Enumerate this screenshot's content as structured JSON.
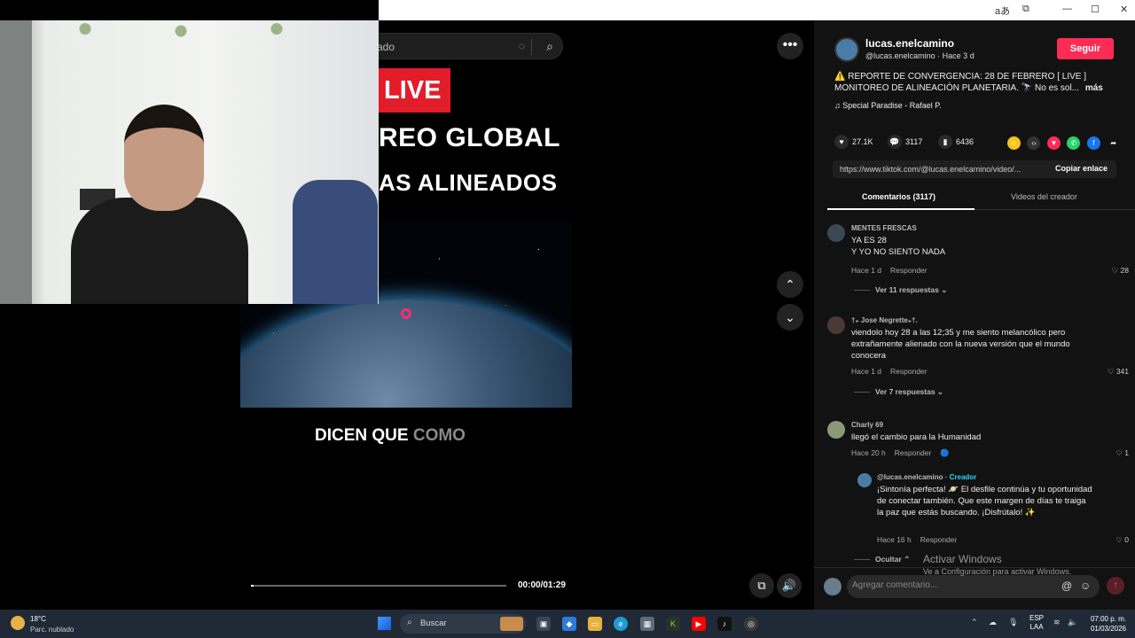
{
  "titlebar": {
    "controls": [
      "aあ",
      "⧉",
      "—",
      "☐",
      "✕"
    ]
  },
  "video": {
    "search_text": "ado",
    "live_badge": "LIVE",
    "headline_1": "REO GLOBAL",
    "headline_2": "AS ALINEADOS",
    "subtitle_bright": "DICEN QUE",
    "subtitle_dim": "COMO",
    "time": "00:00/01:29",
    "progress": 0.0
  },
  "post": {
    "username": "lucas.enelcamino",
    "handle_meta": "@lucas.enelcamino · Hace 3 d",
    "follow_label": "Seguir",
    "description": "⚠️ REPORTE DE CONVERGENCIA: 28 DE FEBRERO [ LIVE ] MONITOREO DE ALINEACIÓN PLANETARIA. 🔭 No es sol...",
    "more_label": "más",
    "music": "♫  Special Paradise - Rafael P.",
    "likes": "27.1K",
    "comments_count": "3117",
    "saves": "6436",
    "url": "https://www.tiktok.com/@lucas.enelcamino/video/...",
    "copy_label": "Copiar enlace"
  },
  "tabs": {
    "comments": "Comentarios (3117)",
    "creator_videos": "Videos del creador"
  },
  "comments": [
    {
      "user": "MENTES FRESCAS",
      "text": "YA ES 28\nY YO NO SIENTO NADA",
      "time": "Hace 1 d",
      "reply": "Responder",
      "likes": "28",
      "replies": "Ver 11 respuestas ⌄"
    },
    {
      "user": "†₊ Jose Negrette₊†.",
      "text": "viendolo hoy 28 a las 12;35 y me siento melancólico pero extrañamente alienado con la nueva versión que el mundo conocera",
      "time": "Hace 1 d",
      "reply": "Responder",
      "likes": "341",
      "replies": "Ver 7 respuestas ⌄"
    },
    {
      "user": "Charly 69",
      "text": "llegó el cambio para la Humanidad",
      "time": "Hace 20 h",
      "reply": "Responder",
      "likes": "1"
    }
  ],
  "creator_reply": {
    "user": "@lucas.enelcamino",
    "tag": " · Creador",
    "text": "¡Sintonía perfecta! 🪐 El desfile continúa y tu oportunidad de conectar también. Que este margen de días te traiga la paz que estás buscando. ¡Disfrútalo! ✨",
    "time": "Hace 16 h",
    "reply": "Responder",
    "likes": "0",
    "hide": "Ocultar ⌃"
  },
  "comment_input": {
    "placeholder": "Agregar comentario..."
  },
  "watermark": {
    "line1": "Activar Windows",
    "line2": "Ve a Configuración para activar Windows."
  },
  "taskbar": {
    "temp": "18°C",
    "condition": "Parc. nublado",
    "search": "Buscar",
    "lang_1": "ESP",
    "lang_2": "LAA",
    "time": "07:00 p. m.",
    "date": "01/03/2026"
  },
  "colors": {
    "accent": "#fe2c55",
    "live_red": "#e11d2a",
    "creator_tag": "#2bd5ff"
  }
}
